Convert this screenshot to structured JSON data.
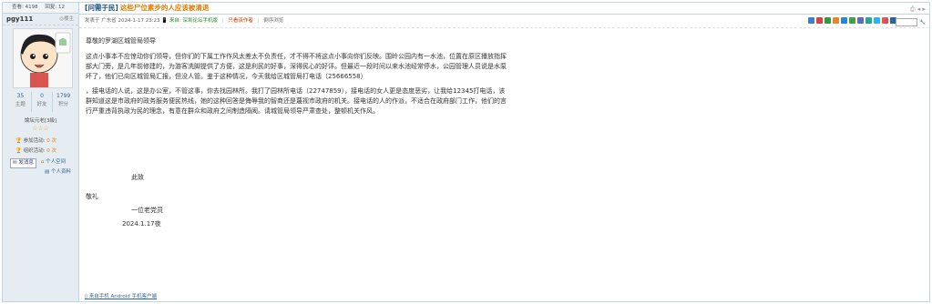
{
  "sidebar": {
    "stats": [
      "查看: 4198",
      "回复: 12"
    ],
    "username": "pgy111",
    "user_tag": "◎楼主",
    "counts": [
      {
        "value": "35",
        "label": "主题"
      },
      {
        "value": "0",
        "label": "好友"
      },
      {
        "value": "1799",
        "label": "积分"
      }
    ],
    "rank": "論坛元老[3級]",
    "stars": "☆☆☆",
    "lines": [
      {
        "prefix": "参加活动:",
        "value": "0 次"
      },
      {
        "prefix": "组织活动:",
        "value": "0 次"
      }
    ],
    "message_label": "发消息",
    "space_label": "个人空间",
    "profile_label": "个人资料"
  },
  "post": {
    "title": "[问需于民]",
    "title_text": "这些尸位素步的人应该被清退",
    "page_controls": "⎙ ◂ ▸",
    "meta": {
      "posted": "发表于 广东省 2024-1-17 23:23",
      "source": "来自: 深圳论坛手机版",
      "only_author": "只看该作者",
      "reverse": "倒序浏览"
    },
    "font_label": "字体",
    "paragraphs": [
      "尊敬的罗湖区城管局领导",
      "这点小事本不应惊动你们领导，但你们的下属工作作风太差太不负责任，才不得不将这点小事向你们反映。围岭公园内有一水池，位置在原区播放指挥部大门旁，是几年前修建的，为游客洗脚提供了方便，这是利民的好事，深得民心的好评。但最近一段时间以来水池经常停水，公园管理人员说是水泵坏了，他们已向区城管局汇报，但没人管。鉴于这种情况，今天我给区城管局打电话（25666558）",
      "，接电话的人说，这是办公室，不管这事，你去找园林所。我打了园林所电话（22747859），接电话的女人更是态度恶劣，让我给12345打电话，该群知道这是市政府的政务服务便民热线，她的这种回答是侮辱我的智商还是蔑视市政府的机关。接电话的人的作派，不适合在政府部门工作，他们的言行严重违背执政为民的理念，有意在群众和政府之间制造隔阂。请城管局领导严肃查处，整顿机关作风。"
    ],
    "closing": "此致",
    "salute": "敬礼",
    "signature": "一位老党员",
    "date": "2024.1.17夜",
    "footer_link": "来自手机 Android 手机客户端"
  },
  "colors": {
    "sidebar_bg": "#e5edf2",
    "border": "#c2d5e3",
    "title": "#1a4f7a"
  }
}
